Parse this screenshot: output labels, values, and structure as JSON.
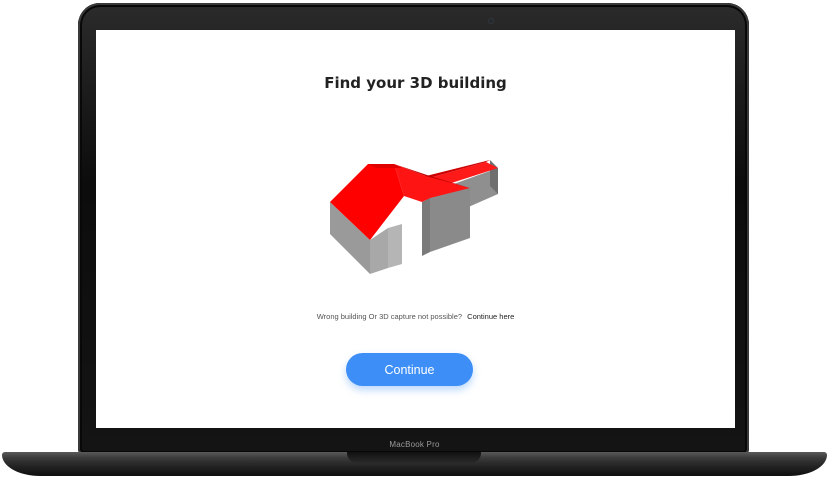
{
  "screen": {
    "title": "Find your 3D building",
    "hint": {
      "text": "Wrong building Or 3D capture not possible?",
      "link": "Continue here"
    },
    "continue_button": "Continue",
    "building_image": "3d-building-model"
  },
  "device": {
    "bezel_label": "MacBook Pro"
  },
  "colors": {
    "accent": "#3d8ef7",
    "roof": "#ff0000",
    "wall": "#8c8c8c"
  }
}
